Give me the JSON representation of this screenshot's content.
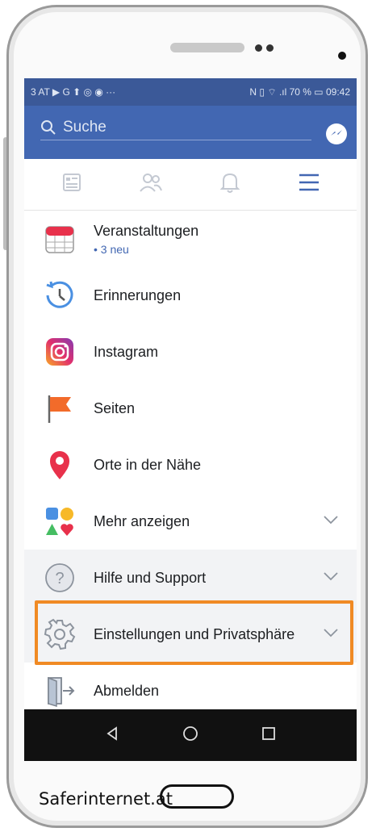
{
  "statusbar": {
    "left": "3 AT ▶ G ⬆ ◎ ◉ ···",
    "right": "N ▯ ⌔ .ıl 70 % ▭ 09:42"
  },
  "search": {
    "placeholder": "Suche"
  },
  "menu": {
    "items": [
      {
        "label": "Veranstaltungen",
        "sub": "• 3 neu"
      },
      {
        "label": "Erinnerungen"
      },
      {
        "label": "Instagram"
      },
      {
        "label": "Seiten"
      },
      {
        "label": "Orte in der Nähe"
      },
      {
        "label": "Mehr anzeigen"
      },
      {
        "label": "Hilfe und Support"
      },
      {
        "label": "Einstellungen und Privatsphäre"
      },
      {
        "label": "Abmelden"
      }
    ]
  },
  "watermark": "Saferinternet.at",
  "colors": {
    "facebook_blue": "#4267b2",
    "highlight": "#f08a24"
  }
}
